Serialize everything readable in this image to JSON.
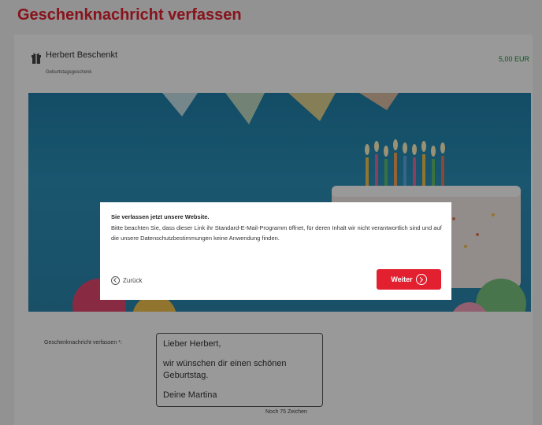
{
  "page": {
    "title": "Geschenknachricht verfassen"
  },
  "product": {
    "icon": "gift-icon",
    "name": "Herbert Beschenkt",
    "subtitle": "Geburtstagsgeschenk",
    "price": "5,00 EUR",
    "price_color": "#1d8a3c"
  },
  "modal": {
    "title": "Sie verlassen jetzt unsere Website.",
    "text": "Bitte beachten Sie, dass dieser Link ihr Standard-E-Mail-Programm öffnet, für deren Inhalt wir nicht verantwortlich sind und auf die unsere Datenschutzbestimmungen keine Anwendung finden.",
    "back_label": "Zurück",
    "next_label": "Weiter",
    "back_icon": "chevron-left-circle-icon",
    "next_icon": "chevron-right-circle-icon"
  },
  "message": {
    "label": "Geschenknachricht verfassen *:",
    "lines": [
      "Lieber Herbert,",
      "wir wünschen dir einen schönen Geburtstag.",
      "Deine Martina"
    ],
    "counter": "Noch 75 Zeichen"
  },
  "colors": {
    "accent": "#e2202f",
    "price": "#1d8a3c"
  }
}
